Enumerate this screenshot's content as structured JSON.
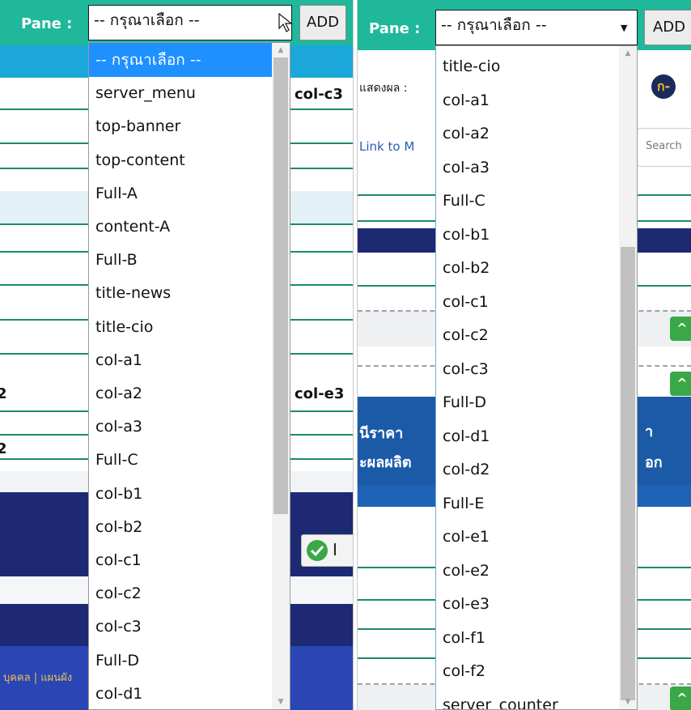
{
  "left": {
    "pane_label": "Pane :",
    "selected_value": "-- กรุณาเลือก --",
    "add_label": "ADD",
    "options": [
      "-- กรุณาเลือก --",
      "server_menu",
      "top-banner",
      "top-content",
      "Full-A",
      "content-A",
      "Full-B",
      "title-news",
      "title-cio",
      "col-a1",
      "col-a2",
      "col-a3",
      "Full-C",
      "col-b1",
      "col-b2",
      "col-c1",
      "col-c2",
      "col-c3",
      "Full-D",
      "col-d1"
    ],
    "bg_text_col_c3": "col-c3",
    "bg_text_col_e3": "col-e3",
    "bg_text_digit": "2",
    "bg_text_digit2": "2",
    "badge_text": "I",
    "footer_text": "บุคคล | แผนผัง"
  },
  "right": {
    "pane_label": "Pane :",
    "selected_value": "-- กรุณาเลือก --",
    "add_label": "ADD",
    "options": [
      "title-cio",
      "col-a1",
      "col-a2",
      "col-a3",
      "Full-C",
      "col-b1",
      "col-b2",
      "col-c1",
      "col-c2",
      "col-c3",
      "Full-D",
      "col-d1",
      "col-d2",
      "Full-E",
      "col-e1",
      "col-e2",
      "col-e3",
      "col-f1",
      "col-f2",
      "server_counter"
    ],
    "bg_display_label": "แสดงผล :",
    "bg_link_text": "Link to M",
    "bg_search_placeholder": "Search",
    "bg_price_text": "นีราคา",
    "bg_product_text": "ะผลผลิต",
    "bg_right_char1": "า",
    "bg_right_char2": "อก",
    "circle1": "ก",
    "circle2": "ก-"
  },
  "colors": {
    "topbar": "#1fb89a",
    "selected_option": "#1e90ff",
    "navy": "#1d2a73",
    "green_button": "#3aa846"
  }
}
